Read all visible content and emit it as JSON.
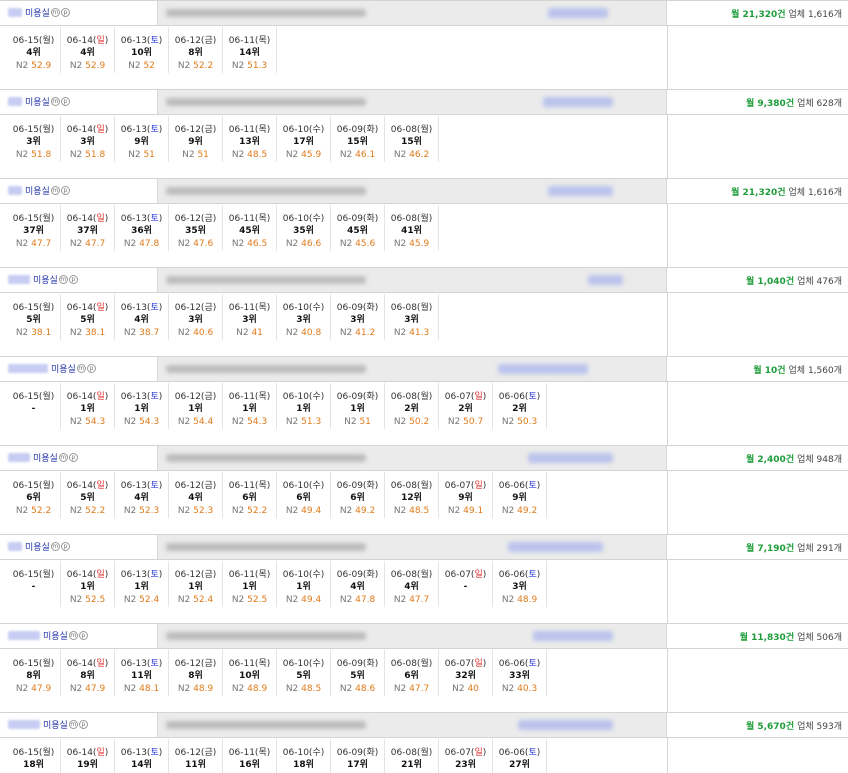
{
  "category_label": "미용실",
  "mp_badges": [
    "m",
    "p"
  ],
  "n2_prefix": "N2",
  "monthly_suffix": "건",
  "biz_prefix": "업체",
  "biz_suffix": "개",
  "entries": [
    {
      "monthly": "월 21,320",
      "business_count": "1,616",
      "dates": [
        {
          "d": "06-15",
          "w": "월",
          "wc": "",
          "rank": "4위",
          "n2": "52.9"
        },
        {
          "d": "06-14",
          "w": "일",
          "wc": "sun",
          "rank": "4위",
          "n2": "52.9"
        },
        {
          "d": "06-13",
          "w": "토",
          "wc": "sat",
          "rank": "10위",
          "n2": "52"
        },
        {
          "d": "06-12",
          "w": "금",
          "wc": "",
          "rank": "8위",
          "n2": "52.2"
        },
        {
          "d": "06-11",
          "w": "목",
          "wc": "",
          "rank": "14위",
          "n2": "51.3"
        }
      ]
    },
    {
      "monthly": "월 9,380",
      "business_count": "628",
      "dates": [
        {
          "d": "06-15",
          "w": "월",
          "wc": "",
          "rank": "3위",
          "n2": "51.8"
        },
        {
          "d": "06-14",
          "w": "일",
          "wc": "sun",
          "rank": "3위",
          "n2": "51.8"
        },
        {
          "d": "06-13",
          "w": "토",
          "wc": "sat",
          "rank": "9위",
          "n2": "51"
        },
        {
          "d": "06-12",
          "w": "금",
          "wc": "",
          "rank": "9위",
          "n2": "51"
        },
        {
          "d": "06-11",
          "w": "목",
          "wc": "",
          "rank": "13위",
          "n2": "48.5"
        },
        {
          "d": "06-10",
          "w": "수",
          "wc": "",
          "rank": "17위",
          "n2": "45.9"
        },
        {
          "d": "06-09",
          "w": "화",
          "wc": "",
          "rank": "15위",
          "n2": "46.1"
        },
        {
          "d": "06-08",
          "w": "월",
          "wc": "",
          "rank": "15위",
          "n2": "46.2"
        }
      ]
    },
    {
      "monthly": "월 21,320",
      "business_count": "1,616",
      "dates": [
        {
          "d": "06-15",
          "w": "월",
          "wc": "",
          "rank": "37위",
          "n2": "47.7"
        },
        {
          "d": "06-14",
          "w": "일",
          "wc": "sun",
          "rank": "37위",
          "n2": "47.7"
        },
        {
          "d": "06-13",
          "w": "토",
          "wc": "sat",
          "rank": "36위",
          "n2": "47.8"
        },
        {
          "d": "06-12",
          "w": "금",
          "wc": "",
          "rank": "35위",
          "n2": "47.6"
        },
        {
          "d": "06-11",
          "w": "목",
          "wc": "",
          "rank": "45위",
          "n2": "46.5"
        },
        {
          "d": "06-10",
          "w": "수",
          "wc": "",
          "rank": "35위",
          "n2": "46.6"
        },
        {
          "d": "06-09",
          "w": "화",
          "wc": "",
          "rank": "45위",
          "n2": "45.6"
        },
        {
          "d": "06-08",
          "w": "월",
          "wc": "",
          "rank": "41위",
          "n2": "45.9"
        }
      ]
    },
    {
      "monthly": "월 1,040",
      "business_count": "476",
      "dates": [
        {
          "d": "06-15",
          "w": "월",
          "wc": "",
          "rank": "5위",
          "n2": "38.1"
        },
        {
          "d": "06-14",
          "w": "일",
          "wc": "sun",
          "rank": "5위",
          "n2": "38.1"
        },
        {
          "d": "06-13",
          "w": "토",
          "wc": "sat",
          "rank": "4위",
          "n2": "38.7"
        },
        {
          "d": "06-12",
          "w": "금",
          "wc": "",
          "rank": "3위",
          "n2": "40.6"
        },
        {
          "d": "06-11",
          "w": "목",
          "wc": "",
          "rank": "3위",
          "n2": "41"
        },
        {
          "d": "06-10",
          "w": "수",
          "wc": "",
          "rank": "3위",
          "n2": "40.8"
        },
        {
          "d": "06-09",
          "w": "화",
          "wc": "",
          "rank": "3위",
          "n2": "41.2"
        },
        {
          "d": "06-08",
          "w": "월",
          "wc": "",
          "rank": "3위",
          "n2": "41.3"
        }
      ]
    },
    {
      "monthly": "월 10",
      "business_count": "1,560",
      "dates": [
        {
          "d": "06-15",
          "w": "월",
          "wc": "",
          "rank": "-",
          "n2": ""
        },
        {
          "d": "06-14",
          "w": "일",
          "wc": "sun",
          "rank": "1위",
          "n2": "54.3"
        },
        {
          "d": "06-13",
          "w": "토",
          "wc": "sat",
          "rank": "1위",
          "n2": "54.3"
        },
        {
          "d": "06-12",
          "w": "금",
          "wc": "",
          "rank": "1위",
          "n2": "54.4"
        },
        {
          "d": "06-11",
          "w": "목",
          "wc": "",
          "rank": "1위",
          "n2": "54.3"
        },
        {
          "d": "06-10",
          "w": "수",
          "wc": "",
          "rank": "1위",
          "n2": "51.3"
        },
        {
          "d": "06-09",
          "w": "화",
          "wc": "",
          "rank": "1위",
          "n2": "51"
        },
        {
          "d": "06-08",
          "w": "월",
          "wc": "",
          "rank": "2위",
          "n2": "50.2"
        },
        {
          "d": "06-07",
          "w": "일",
          "wc": "sun",
          "rank": "2위",
          "n2": "50.7"
        },
        {
          "d": "06-06",
          "w": "토",
          "wc": "sat",
          "rank": "2위",
          "n2": "50.3"
        }
      ]
    },
    {
      "monthly": "월 2,400",
      "business_count": "948",
      "dates": [
        {
          "d": "06-15",
          "w": "월",
          "wc": "",
          "rank": "6위",
          "n2": "52.2"
        },
        {
          "d": "06-14",
          "w": "일",
          "wc": "sun",
          "rank": "5위",
          "n2": "52.2"
        },
        {
          "d": "06-13",
          "w": "토",
          "wc": "sat",
          "rank": "4위",
          "n2": "52.3"
        },
        {
          "d": "06-12",
          "w": "금",
          "wc": "",
          "rank": "4위",
          "n2": "52.3"
        },
        {
          "d": "06-11",
          "w": "목",
          "wc": "",
          "rank": "6위",
          "n2": "52.2"
        },
        {
          "d": "06-10",
          "w": "수",
          "wc": "",
          "rank": "6위",
          "n2": "49.4"
        },
        {
          "d": "06-09",
          "w": "화",
          "wc": "",
          "rank": "6위",
          "n2": "49.2"
        },
        {
          "d": "06-08",
          "w": "월",
          "wc": "",
          "rank": "12위",
          "n2": "48.5"
        },
        {
          "d": "06-07",
          "w": "일",
          "wc": "sun",
          "rank": "9위",
          "n2": "49.1"
        },
        {
          "d": "06-06",
          "w": "토",
          "wc": "sat",
          "rank": "9위",
          "n2": "49.2"
        }
      ]
    },
    {
      "monthly": "월 7,190",
      "business_count": "291",
      "dates": [
        {
          "d": "06-15",
          "w": "월",
          "wc": "",
          "rank": "-",
          "n2": ""
        },
        {
          "d": "06-14",
          "w": "일",
          "wc": "sun",
          "rank": "1위",
          "n2": "52.5"
        },
        {
          "d": "06-13",
          "w": "토",
          "wc": "sat",
          "rank": "1위",
          "n2": "52.4"
        },
        {
          "d": "06-12",
          "w": "금",
          "wc": "",
          "rank": "1위",
          "n2": "52.4"
        },
        {
          "d": "06-11",
          "w": "목",
          "wc": "",
          "rank": "1위",
          "n2": "52.5"
        },
        {
          "d": "06-10",
          "w": "수",
          "wc": "",
          "rank": "1위",
          "n2": "49.4"
        },
        {
          "d": "06-09",
          "w": "화",
          "wc": "",
          "rank": "4위",
          "n2": "47.8"
        },
        {
          "d": "06-08",
          "w": "월",
          "wc": "",
          "rank": "4위",
          "n2": "47.7"
        },
        {
          "d": "06-07",
          "w": "일",
          "wc": "sun",
          "rank": "-",
          "n2": ""
        },
        {
          "d": "06-06",
          "w": "토",
          "wc": "sat",
          "rank": "3위",
          "n2": "48.9"
        }
      ]
    },
    {
      "monthly": "월 11,830",
      "business_count": "506",
      "dates": [
        {
          "d": "06-15",
          "w": "월",
          "wc": "",
          "rank": "8위",
          "n2": "47.9"
        },
        {
          "d": "06-14",
          "w": "일",
          "wc": "sun",
          "rank": "8위",
          "n2": "47.9"
        },
        {
          "d": "06-13",
          "w": "토",
          "wc": "sat",
          "rank": "11위",
          "n2": "48.1"
        },
        {
          "d": "06-12",
          "w": "금",
          "wc": "",
          "rank": "8위",
          "n2": "48.9"
        },
        {
          "d": "06-11",
          "w": "목",
          "wc": "",
          "rank": "10위",
          "n2": "48.9"
        },
        {
          "d": "06-10",
          "w": "수",
          "wc": "",
          "rank": "5위",
          "n2": "48.5"
        },
        {
          "d": "06-09",
          "w": "화",
          "wc": "",
          "rank": "5위",
          "n2": "48.6"
        },
        {
          "d": "06-08",
          "w": "월",
          "wc": "",
          "rank": "6위",
          "n2": "47.7"
        },
        {
          "d": "06-07",
          "w": "일",
          "wc": "sun",
          "rank": "32위",
          "n2": "40"
        },
        {
          "d": "06-06",
          "w": "토",
          "wc": "sat",
          "rank": "33위",
          "n2": "40.3"
        }
      ]
    },
    {
      "monthly": "월 5,670",
      "business_count": "593",
      "dates": [
        {
          "d": "06-15",
          "w": "월",
          "wc": "",
          "rank": "18위",
          "n2": ""
        },
        {
          "d": "06-14",
          "w": "일",
          "wc": "sun",
          "rank": "19위",
          "n2": ""
        },
        {
          "d": "06-13",
          "w": "토",
          "wc": "sat",
          "rank": "14위",
          "n2": ""
        },
        {
          "d": "06-12",
          "w": "금",
          "wc": "",
          "rank": "11위",
          "n2": ""
        },
        {
          "d": "06-11",
          "w": "목",
          "wc": "",
          "rank": "16위",
          "n2": ""
        },
        {
          "d": "06-10",
          "w": "수",
          "wc": "",
          "rank": "18위",
          "n2": ""
        },
        {
          "d": "06-09",
          "w": "화",
          "wc": "",
          "rank": "17위",
          "n2": ""
        },
        {
          "d": "06-08",
          "w": "월",
          "wc": "",
          "rank": "21위",
          "n2": ""
        },
        {
          "d": "06-07",
          "w": "일",
          "wc": "sun",
          "rank": "23위",
          "n2": ""
        },
        {
          "d": "06-06",
          "w": "토",
          "wc": "sat",
          "rank": "27위",
          "n2": ""
        }
      ]
    }
  ]
}
